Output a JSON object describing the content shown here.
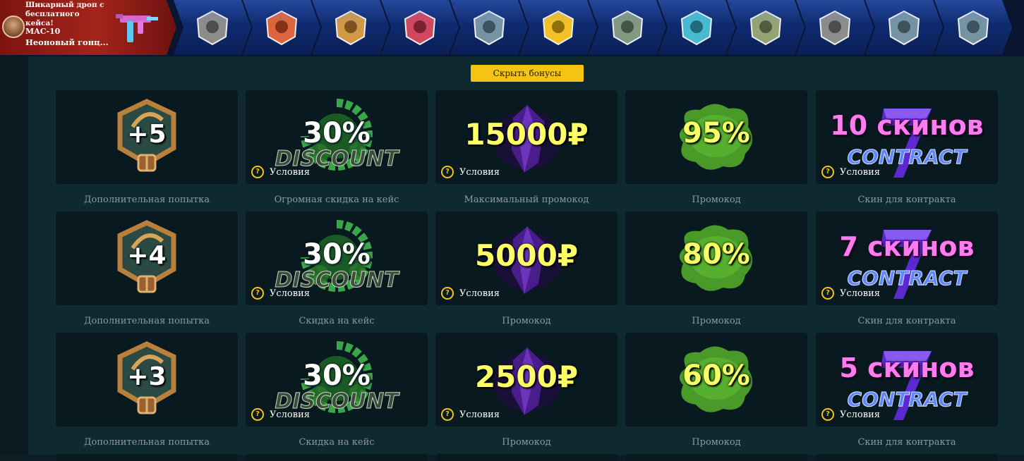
{
  "live_drop": {
    "featured": {
      "title": "Шикарный дроп с бесплатного кейса!",
      "weapon": "MAC-10",
      "skin": "Неоновый гонц..."
    },
    "items": [
      {
        "icon": "skull-sticker-icon"
      },
      {
        "icon": "navi-sticker-icon"
      },
      {
        "icon": "team-sticker-icon"
      },
      {
        "icon": "shiro-sticker-icon"
      },
      {
        "icon": "acor-sticker-icon"
      },
      {
        "icon": "dragon-sticker-icon"
      },
      {
        "icon": "knife-icon"
      },
      {
        "icon": "gloves-sticker-icon"
      },
      {
        "icon": "rifle-icon"
      },
      {
        "icon": "autograph-sticker-icon"
      },
      {
        "icon": "acor-sticker-icon"
      },
      {
        "icon": "acor-sticker-icon"
      }
    ]
  },
  "bonuses": {
    "toggle_label": "Скрыть бонусы",
    "conditions_label": "Условия",
    "rows": [
      [
        {
          "type": "attempt",
          "value": "+5",
          "caption": "Дополнительная попытка",
          "has_conditions": false
        },
        {
          "type": "discount",
          "value": "30%",
          "word": "DISCOUNT",
          "caption": "Огромная скидка на кейс",
          "has_conditions": true
        },
        {
          "type": "promo-max",
          "value": "15000₽",
          "caption": "Максимальный промокод",
          "has_conditions": true
        },
        {
          "type": "promo",
          "value": "95%",
          "caption": "Промокод",
          "has_conditions": false
        },
        {
          "type": "contract",
          "value": "10 скинов",
          "word": "CONTRACT",
          "caption": "Скин для контракта",
          "has_conditions": true
        }
      ],
      [
        {
          "type": "attempt",
          "value": "+4",
          "caption": "Дополнительная попытка",
          "has_conditions": false
        },
        {
          "type": "discount",
          "value": "30%",
          "word": "DISCOUNT",
          "caption": "Скидка на кейс",
          "has_conditions": true
        },
        {
          "type": "promo-max",
          "value": "5000₽",
          "caption": "Промокод",
          "has_conditions": true
        },
        {
          "type": "promo",
          "value": "80%",
          "caption": "Промокод",
          "has_conditions": false
        },
        {
          "type": "contract",
          "value": "7 скинов",
          "word": "CONTRACT",
          "caption": "Скин для контракта",
          "has_conditions": true
        }
      ],
      [
        {
          "type": "attempt",
          "value": "+3",
          "caption": "Дополнительная попытка",
          "has_conditions": false
        },
        {
          "type": "discount",
          "value": "30%",
          "word": "DISCOUNT",
          "caption": "Скидка на кейс",
          "has_conditions": true
        },
        {
          "type": "promo-max",
          "value": "2500₽",
          "caption": "Промокод",
          "has_conditions": true
        },
        {
          "type": "promo",
          "value": "60%",
          "caption": "Промокод",
          "has_conditions": false
        },
        {
          "type": "contract",
          "value": "5 скинов",
          "word": "CONTRACT",
          "caption": "Скин для контракта",
          "has_conditions": true
        }
      ]
    ]
  },
  "colors": {
    "accent": "#f5c313",
    "background": "#0f2931",
    "card": "#081a1f",
    "drop_bar": "#0e2a6e",
    "featured_drop": "#a3241b"
  }
}
